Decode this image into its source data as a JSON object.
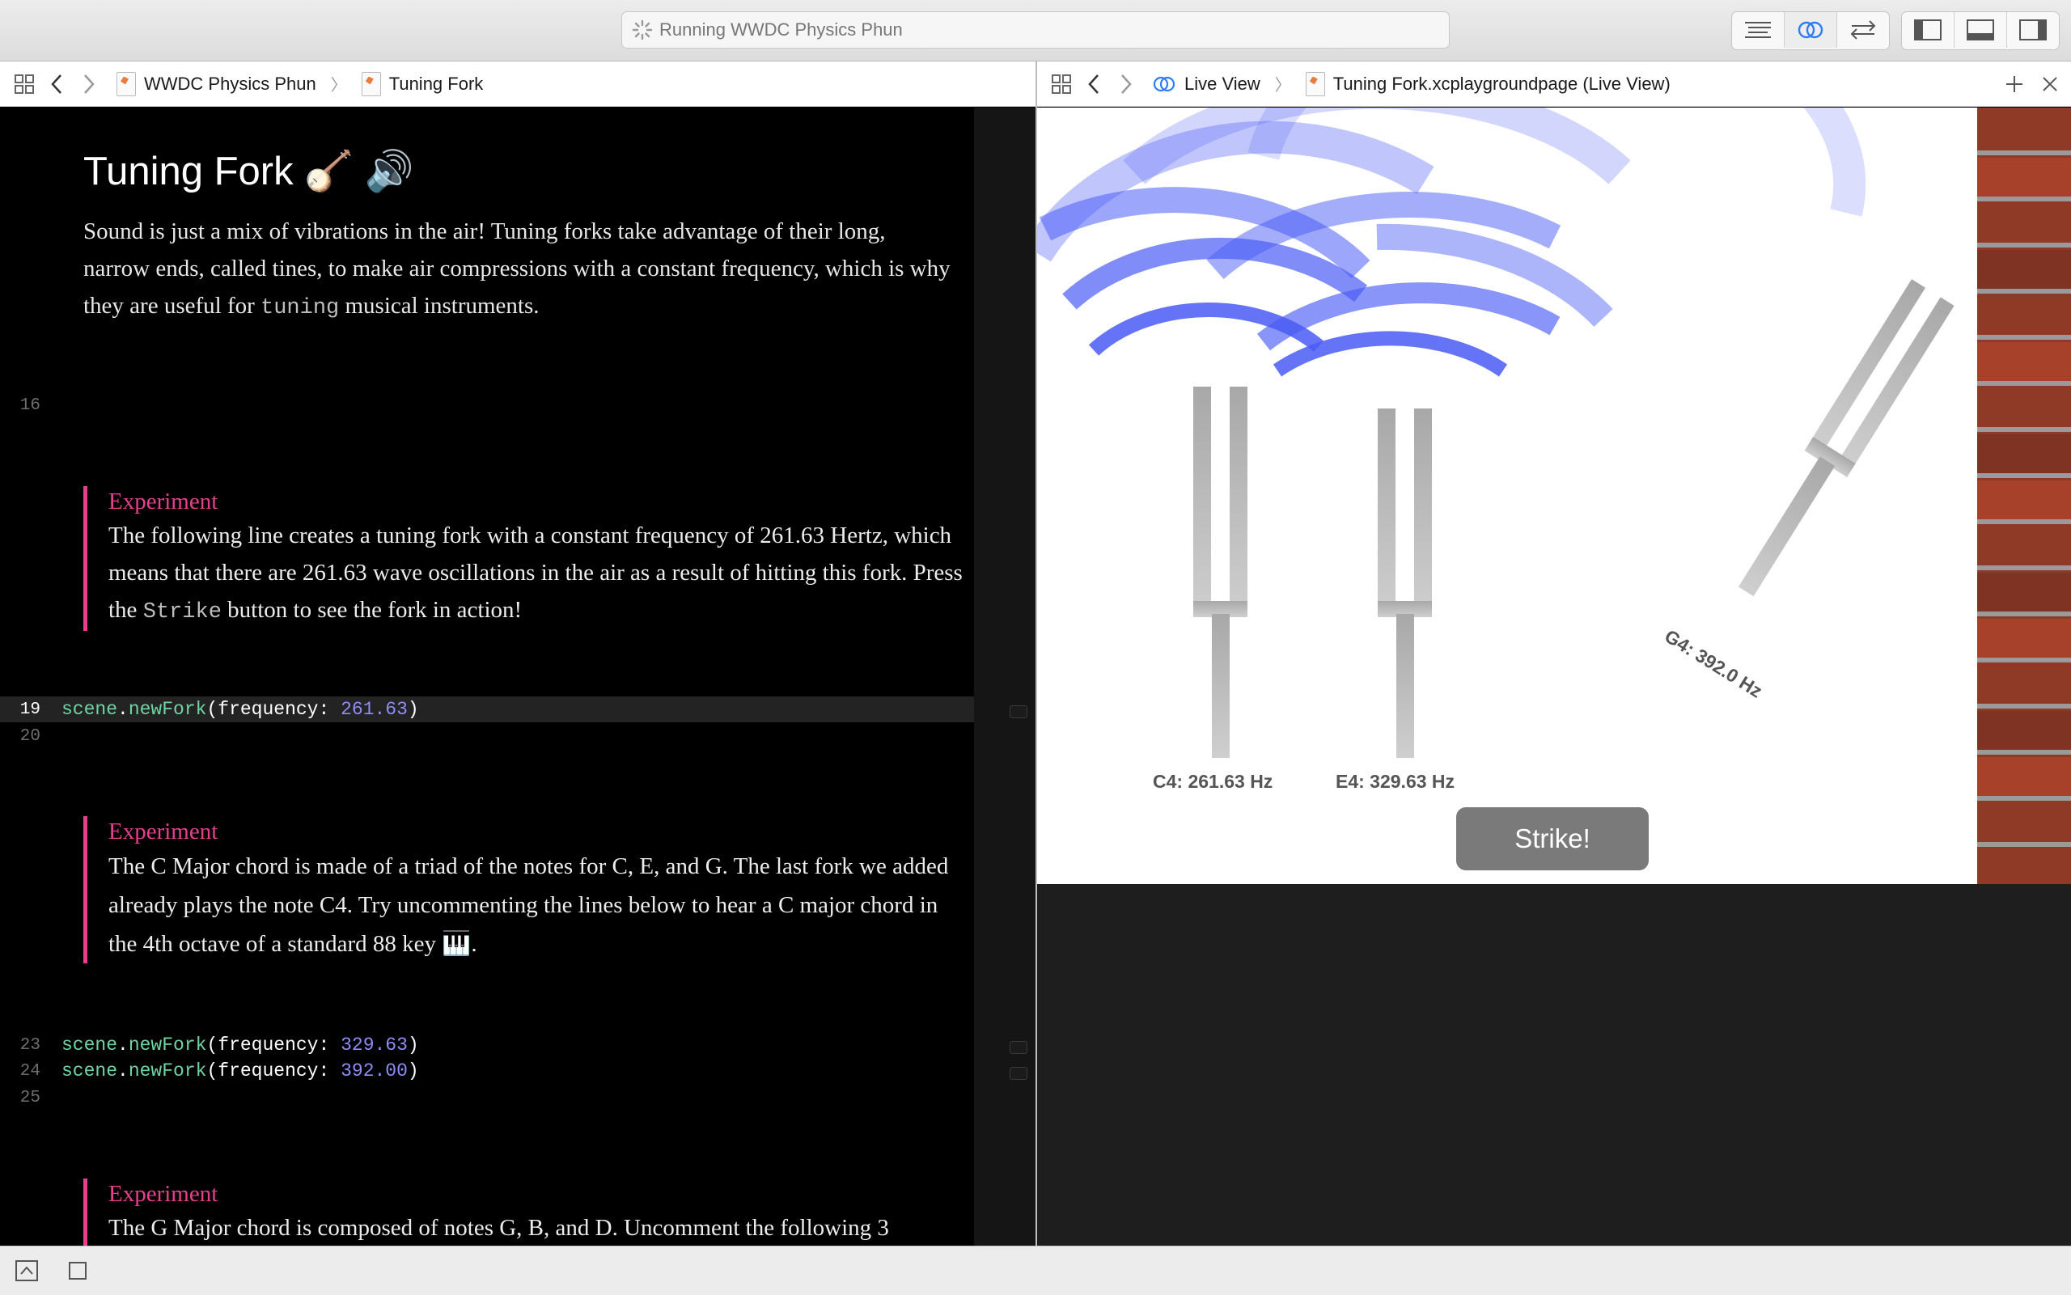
{
  "window": {
    "activity_text": "Running WWDC Physics Phun"
  },
  "left_jumpbar": {
    "crumbs": [
      "WWDC Physics Phun",
      "Tuning Fork"
    ]
  },
  "right_jumpbar": {
    "crumbs": [
      "Live View",
      "Tuning Fork.xcplaygroundpage (Live View)"
    ]
  },
  "editor": {
    "title": "Tuning Fork 🪕 🔊",
    "intro_before": "Sound is just a mix of vibrations in the air! Tuning forks take advantage of their long, narrow ends, called tines, to make air compressions with a constant frequency, which is why they are useful for ",
    "intro_code": "tuning",
    "intro_after": " musical instruments.",
    "experiment1": {
      "label": "Experiment",
      "before": "The following line creates a tuning fork with a constant frequency of 261.63 Hertz, which means that there are 261.63 wave oscillations in the air as a result of hitting this fork. Press the ",
      "code": "Strike",
      "after": " button to see the fork in action!"
    },
    "experiment2": {
      "label": "Experiment",
      "text": "The C Major chord is made of a triad of the notes for C, E, and G. The last fork we added already plays the note C4. Try uncommenting the lines below to hear a C major chord in the 4th octave of a standard 88 key 🎹."
    },
    "experiment3": {
      "label": "Experiment",
      "text": "The G Major chord is composed of notes G, B, and D. Uncomment the following 3"
    },
    "line_numbers": {
      "l16": "16",
      "l19": "19",
      "l20": "20",
      "l23": "23",
      "l24": "24",
      "l25": "25"
    },
    "code": {
      "obj": "scene",
      "fn": "newFork",
      "param": "frequency: ",
      "values": [
        "261.63",
        "329.63",
        "392.00"
      ]
    }
  },
  "liveview": {
    "forks": [
      {
        "label": "C4: 261.63 Hz"
      },
      {
        "label": "E4: 329.63 Hz"
      },
      {
        "label": "G4: 392.0 Hz"
      }
    ],
    "strike_label": "Strike!"
  },
  "colors": {
    "accent_pink": "#e6408c",
    "code_green": "#6fd4a4",
    "code_number": "#8f8cf5",
    "wave_blue": "#4a5cf5",
    "brick": "#a33a22"
  },
  "icons": [
    "grid-icon",
    "chevron-left-icon",
    "chevron-right-icon",
    "swift-file-icon",
    "playground-page-icon",
    "live-view-icon",
    "plus-icon",
    "close-icon",
    "spinner-icon",
    "editor-standard-icon",
    "editor-assistant-icon",
    "editor-version-icon",
    "navigator-toggle-icon",
    "debug-area-toggle-icon",
    "utilities-toggle-icon",
    "hide-debug-icon",
    "stop-icon"
  ]
}
